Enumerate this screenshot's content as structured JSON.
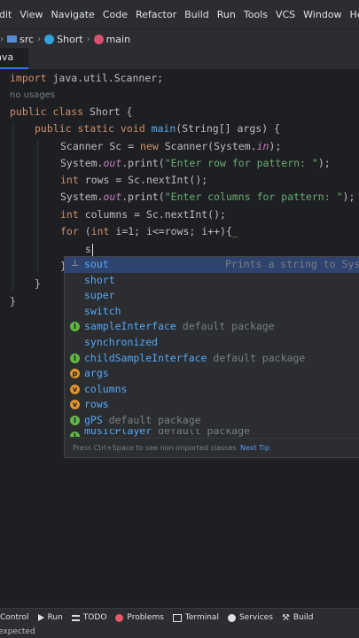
{
  "menu": [
    "dit",
    "View",
    "Navigate",
    "Code",
    "Refactor",
    "Build",
    "Run",
    "Tools",
    "VCS",
    "Window",
    "Help"
  ],
  "breadcrumb": [
    "src",
    "Short",
    "main"
  ],
  "tab": {
    "label": "Java"
  },
  "code": {
    "import_kw": "import",
    "import_rest": " java.util.Scanner;",
    "usages": "no usages",
    "l3_kw": "public class",
    "l3_rest": " Short {",
    "l4_kw": "public static void",
    "l4_fn": "main",
    "l4_rest": "(String[] args) {",
    "l5a": "Scanner Sc = ",
    "l5_kw": "new",
    "l5b": " Scanner(System.",
    "l5_fld": "in",
    "l5c": ");",
    "l6a": "System.",
    "l6_fld": "out",
    "l6b": ".print(",
    "l6_str": "\"Enter row for pattern: \"",
    "l6c": ");",
    "l7_kw": "int",
    "l7_rest": " rows = Sc.nextInt();",
    "l8a": "System.",
    "l8_fld": "out",
    "l8b": ".print(",
    "l8_str": "\"Enter columns for pattern: \"",
    "l8c": ");",
    "l9_kw": "int",
    "l9_rest": " columns = Sc.nextInt();",
    "l10_kw1": "for",
    "l10a": " (",
    "l10_kw2": "int",
    "l10b": " i=1; i<=rows; i++){",
    "typed": "s",
    "close1": "}",
    "close2": "}",
    "close3": "}"
  },
  "completion": {
    "items": [
      {
        "icon": "live-template-icon",
        "name": "sout",
        "hint": "Prints a string to Sys"
      },
      {
        "icon": "keyword",
        "name": "short"
      },
      {
        "icon": "keyword",
        "name": "super"
      },
      {
        "icon": "keyword",
        "name": "switch"
      },
      {
        "icon": "interface-icon",
        "name": "sampleInterface",
        "tail": " default package"
      },
      {
        "icon": "keyword",
        "name": "synchronized"
      },
      {
        "icon": "interface-icon",
        "name": "childSampleInterface",
        "tail": " default package"
      },
      {
        "icon": "parameter-icon",
        "name": "args"
      },
      {
        "icon": "variable-icon",
        "name": "columns"
      },
      {
        "icon": "variable-icon",
        "name": "rows"
      },
      {
        "icon": "interface-icon",
        "name": "gPS",
        "tail": " default package"
      },
      {
        "icon": "interface-icon",
        "name": "musicPlayer",
        "tail": " default package"
      }
    ],
    "footer": "Press Ctrl+Space to see non-imported classes",
    "next_tip": "Next Tip"
  },
  "toolwindows": [
    "Control",
    "Run",
    "TODO",
    "Problems",
    "Terminal",
    "Services",
    "Build"
  ],
  "status": "expected",
  "colors": {
    "accent": "#3574f0",
    "selection": "#2e436e",
    "keyword": "#cf8e6d",
    "string": "#6aab73",
    "function": "#56a8f5",
    "field": "#c77dbb"
  }
}
